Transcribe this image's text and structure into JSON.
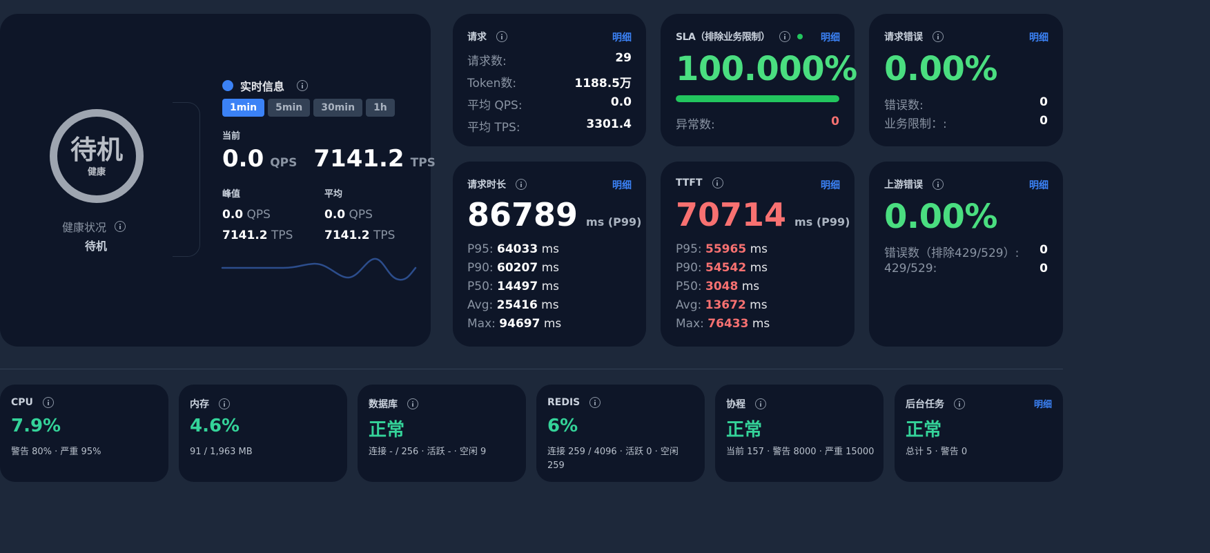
{
  "hero": {
    "health_main": "待机",
    "health_sub": "健康",
    "health_label": "健康状况",
    "health_value": "待机",
    "realtime_title": "实时信息",
    "windows": [
      "1min",
      "5min",
      "30min",
      "1h"
    ],
    "current_label": "当前",
    "current_qps": "0.0",
    "current_tps": "7141.2",
    "qps_unit": "QPS",
    "tps_unit": "TPS",
    "peak_label": "峰值",
    "peak_qps": "0.0",
    "peak_tps": "7141.2",
    "avg_label": "平均",
    "avg_qps": "0.0",
    "avg_tps": "7141.2"
  },
  "detail_label": "明细",
  "requests": {
    "title": "请求",
    "rows": [
      {
        "label": "请求数:",
        "value": "29"
      },
      {
        "label": "Token数:",
        "value": "1188.5万"
      },
      {
        "label": "平均 QPS:",
        "value": "0.0"
      },
      {
        "label": "平均 TPS:",
        "value": "3301.4"
      }
    ]
  },
  "sla": {
    "title": "SLA（排除业务限制）",
    "value": "100.000%",
    "progress": 1.0,
    "abnormal_label": "异常数:",
    "abnormal_value": "0"
  },
  "req_errors": {
    "title": "请求错误",
    "value": "0.00%",
    "rows": [
      {
        "label": "错误数:",
        "value": "0"
      },
      {
        "label": "业务限制：:",
        "value": "0"
      }
    ]
  },
  "duration": {
    "title": "请求时长",
    "big": "86789",
    "big_unit": "ms (P99)",
    "stats": [
      {
        "label": "P95: ",
        "value": "64033",
        "unit": " ms"
      },
      {
        "label": "P90: ",
        "value": "60207",
        "unit": " ms"
      },
      {
        "label": "P50: ",
        "value": "14497",
        "unit": " ms"
      },
      {
        "label": "Avg: ",
        "value": "25416",
        "unit": " ms"
      },
      {
        "label": "Max: ",
        "value": "94697",
        "unit": " ms"
      }
    ]
  },
  "ttft": {
    "title": "TTFT",
    "big": "70714",
    "big_unit": "ms (P99)",
    "stats": [
      {
        "label": "P95: ",
        "value": "55965",
        "unit": " ms"
      },
      {
        "label": "P90: ",
        "value": "54542",
        "unit": " ms"
      },
      {
        "label": "P50: ",
        "value": "3048",
        "unit": " ms"
      },
      {
        "label": "Avg: ",
        "value": "13672",
        "unit": " ms"
      },
      {
        "label": "Max: ",
        "value": "76433",
        "unit": " ms"
      }
    ]
  },
  "upstream": {
    "title": "上游错误",
    "value": "0.00%",
    "rows": [
      {
        "label": "错误数（排除429/529）:",
        "value": "0"
      },
      {
        "label": "429/529:",
        "value": "0"
      }
    ]
  },
  "system": [
    {
      "title": "CPU",
      "value": "7.9%",
      "desc": "警告 80% · 严重 95%"
    },
    {
      "title": "内存",
      "value": "4.6%",
      "desc": "91 / 1,963 MB"
    },
    {
      "title": "数据库",
      "value": "正常",
      "desc": "连接 - / 256 · 活跃 - · 空闲 9"
    },
    {
      "title": "REDIS",
      "value": "6%",
      "desc": "连接 259 / 4096 · 活跃 0 · 空闲 259"
    },
    {
      "title": "协程",
      "value": "正常",
      "desc": "当前 157 · 警告 8000 · 严重 15000"
    },
    {
      "title": "后台任务",
      "value": "正常",
      "desc": "总计 5 · 警告 0",
      "detail": "明细"
    }
  ],
  "colors": {
    "accent": "#3b82f6",
    "good": "#4ade80",
    "bad": "#f87171",
    "sys_value": "#34d399"
  }
}
